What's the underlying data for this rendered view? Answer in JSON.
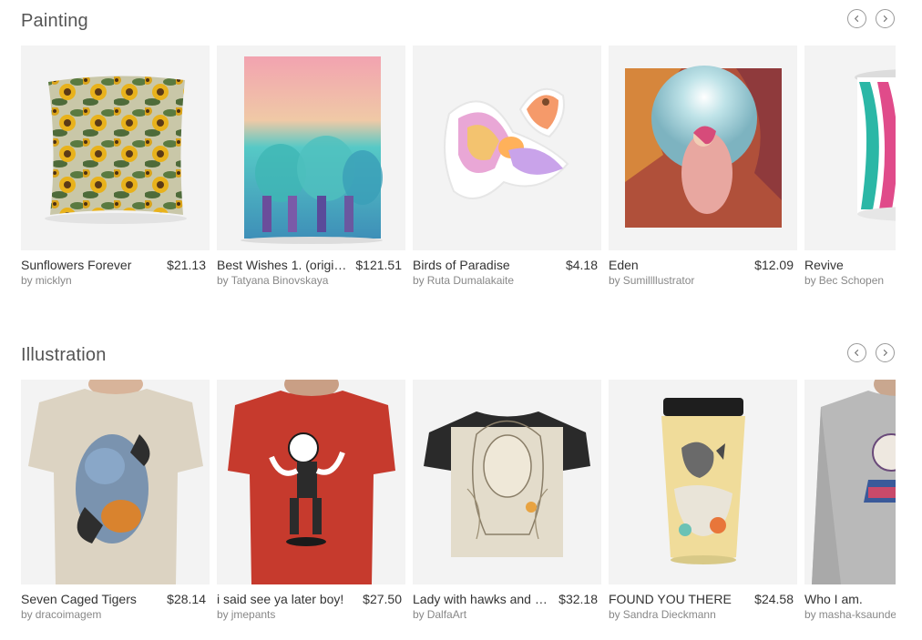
{
  "sections": [
    {
      "title": "Painting",
      "nav": {
        "prev_icon": "chevron-left-icon",
        "next_icon": "chevron-right-icon"
      },
      "items": [
        {
          "title": "Sunflowers Forever",
          "price": "$21.13",
          "by": "by",
          "artist": "micklyn",
          "product": "throw pillow"
        },
        {
          "title": "Best Wishes 1. (original ...",
          "price": "$121.51",
          "by": "by",
          "artist": "Tatyana Binovskaya",
          "product": "duvet cover"
        },
        {
          "title": "Birds of Paradise",
          "price": "$4.18",
          "by": "by",
          "artist": "Ruta Dumalakaite",
          "product": "sticker"
        },
        {
          "title": "Eden",
          "price": "$12.09",
          "by": "by",
          "artist": "Sumillllustrator",
          "product": "art print"
        },
        {
          "title": "Revive",
          "price": "",
          "by": "by",
          "artist": "Bec Schopen",
          "product": "mug"
        }
      ]
    },
    {
      "title": "Illustration",
      "nav": {
        "prev_icon": "chevron-left-icon",
        "next_icon": "chevron-right-icon"
      },
      "items": [
        {
          "title": "Seven Caged Tigers",
          "price": "$28.14",
          "by": "by",
          "artist": "dracoimagem",
          "product": "t-shirt"
        },
        {
          "title": "i said see ya later boy!",
          "price": "$27.50",
          "by": "by",
          "artist": "jmepants",
          "product": "t-shirt"
        },
        {
          "title": "Lady with hawks and a ...",
          "price": "$32.18",
          "by": "by",
          "artist": "DalfaArt",
          "product": "graphic t-shirt"
        },
        {
          "title": "FOUND YOU THERE",
          "price": "$24.58",
          "by": "by",
          "artist": "Sandra Dieckmann",
          "product": "travel mug"
        },
        {
          "title": "Who I am.",
          "price": "",
          "by": "by",
          "artist": "masha-ksaunde",
          "product": "long sleeve t-shirt"
        }
      ]
    }
  ]
}
